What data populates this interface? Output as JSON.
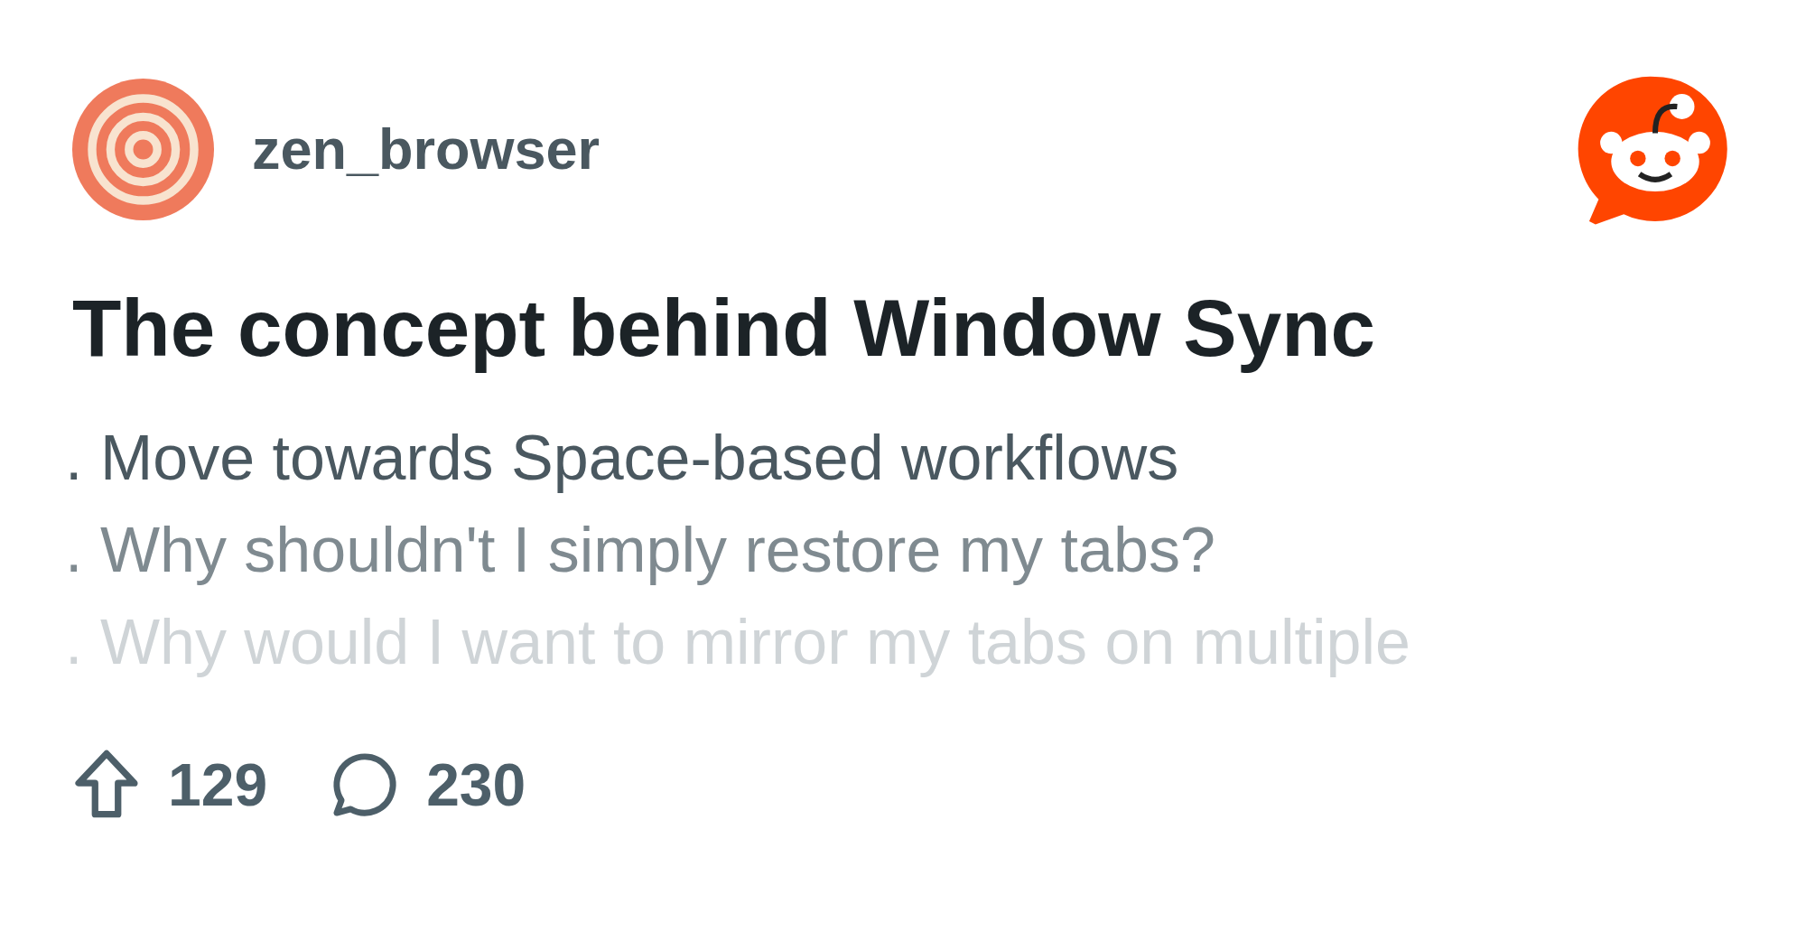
{
  "post": {
    "author": "zen_browser",
    "title": "The concept behind Window Sync",
    "lines": [
      ". Move towards Space-based workflows",
      ". Why shouldn't I simply restore my tabs?",
      ". Why would I want to mirror my tabs on multiple"
    ],
    "upvotes": "129",
    "comments": "230"
  }
}
